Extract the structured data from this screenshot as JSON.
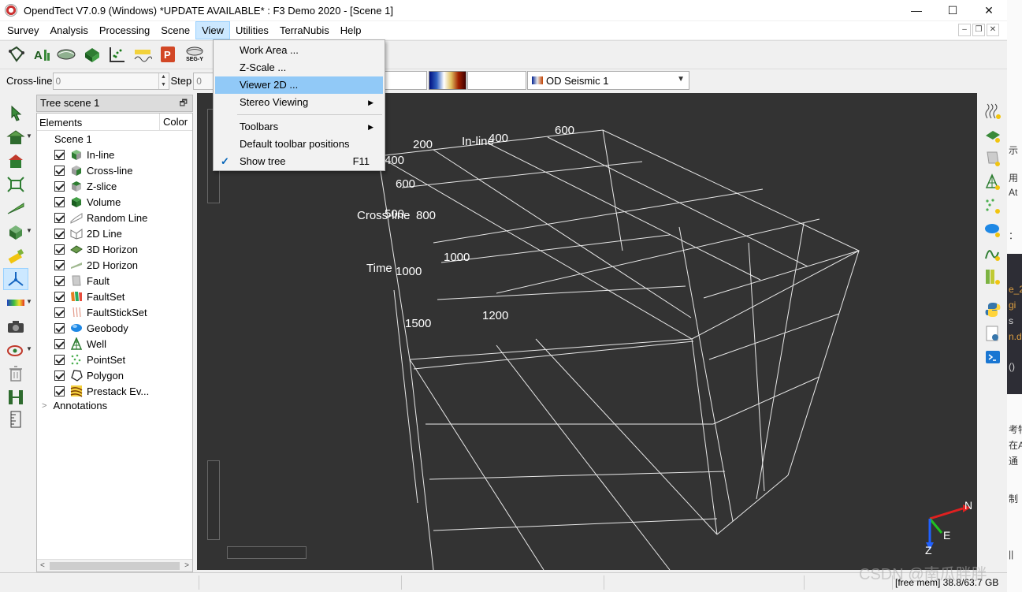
{
  "window": {
    "title": "OpendTect V7.0.9 (Windows)  *UPDATE AVAILABLE*  : F3 Demo 2020 - [Scene 1]",
    "minimize": "—",
    "maximize": "☐",
    "close": "✕"
  },
  "menubar": {
    "items": [
      "Survey",
      "Analysis",
      "Processing",
      "Scene",
      "View",
      "Utilities",
      "TerraNubis",
      "Help"
    ],
    "active": "View"
  },
  "toolbar": {
    "segy_label": "SEG-Y",
    "icons": [
      "survey-setup-icon",
      "attributes-icon",
      "horizon-icon",
      "volume-icon",
      "crossplot-icon",
      "wavelet-icon",
      "powerpoint-icon",
      "segy-icon"
    ]
  },
  "slice_toolbar": {
    "crossline_label": "Cross-line",
    "crossline_value": "0",
    "step_label": "Step",
    "step_value": "0",
    "seismic_select": "OD Seismic 1"
  },
  "tree": {
    "title": "Tree scene 1",
    "col_elements": "Elements",
    "col_color": "Color",
    "root": "Scene 1",
    "items": [
      {
        "label": "In-line",
        "icon": "inline-cube-icon"
      },
      {
        "label": "Cross-line",
        "icon": "crossline-cube-icon"
      },
      {
        "label": "Z-slice",
        "icon": "zslice-cube-icon"
      },
      {
        "label": "Volume",
        "icon": "volume-cube-icon"
      },
      {
        "label": "Random Line",
        "icon": "random-line-icon"
      },
      {
        "label": "2D Line",
        "icon": "2d-line-icon"
      },
      {
        "label": "3D Horizon",
        "icon": "3d-horizon-icon"
      },
      {
        "label": "2D Horizon",
        "icon": "2d-horizon-icon"
      },
      {
        "label": "Fault",
        "icon": "fault-icon"
      },
      {
        "label": "FaultSet",
        "icon": "faultset-icon"
      },
      {
        "label": "FaultStickSet",
        "icon": "faultstickset-icon"
      },
      {
        "label": "Geobody",
        "icon": "geobody-icon"
      },
      {
        "label": "Well",
        "icon": "well-icon"
      },
      {
        "label": "PointSet",
        "icon": "pointset-icon"
      },
      {
        "label": "Polygon",
        "icon": "polygon-icon"
      },
      {
        "label": "Prestack Ev...",
        "icon": "prestack-icon"
      }
    ],
    "annotations": "Annotations"
  },
  "view_menu": {
    "items": [
      {
        "label": "Work Area ..."
      },
      {
        "label": "Z-Scale ..."
      },
      {
        "label": "Viewer 2D ..."
      },
      {
        "label": "Stereo Viewing"
      },
      {
        "label": "Toolbars"
      },
      {
        "label": "Default toolbar positions"
      },
      {
        "label": "Show tree",
        "shortcut": "F11",
        "checked": true
      }
    ],
    "highlighted": "Viewer 2D ..."
  },
  "scene": {
    "background": "#333333",
    "labels": {
      "inline_axis": "In-line",
      "crossline_axis": "Cross-line",
      "time_axis": "Time",
      "inline_400": "400",
      "inline_600": "600",
      "n200": "200",
      "n400": "400",
      "n600": "600",
      "n500": "500",
      "n800": "800",
      "n1000a": "1000",
      "n1000b": "1000",
      "n1200": "1200",
      "n1500": "1500"
    },
    "orient": {
      "n": "N",
      "e": "E",
      "z": "Z"
    }
  },
  "statusbar": {
    "memory": "[free mem] 38.8/63.7 GB"
  },
  "background_app": {
    "fragments": [
      "示",
      "用",
      "At",
      "：",
      "e_2",
      "gi",
      "s",
      "n.d",
      "()",
      "考特",
      "在A",
      "通",
      "制",
      "||"
    ]
  },
  "watermark": "CSDN @南瓜胖胖",
  "colors": {
    "menu_highlight": "#91c9f7",
    "viewer_bg": "#333333",
    "active_menu_bg": "#cce8ff"
  }
}
